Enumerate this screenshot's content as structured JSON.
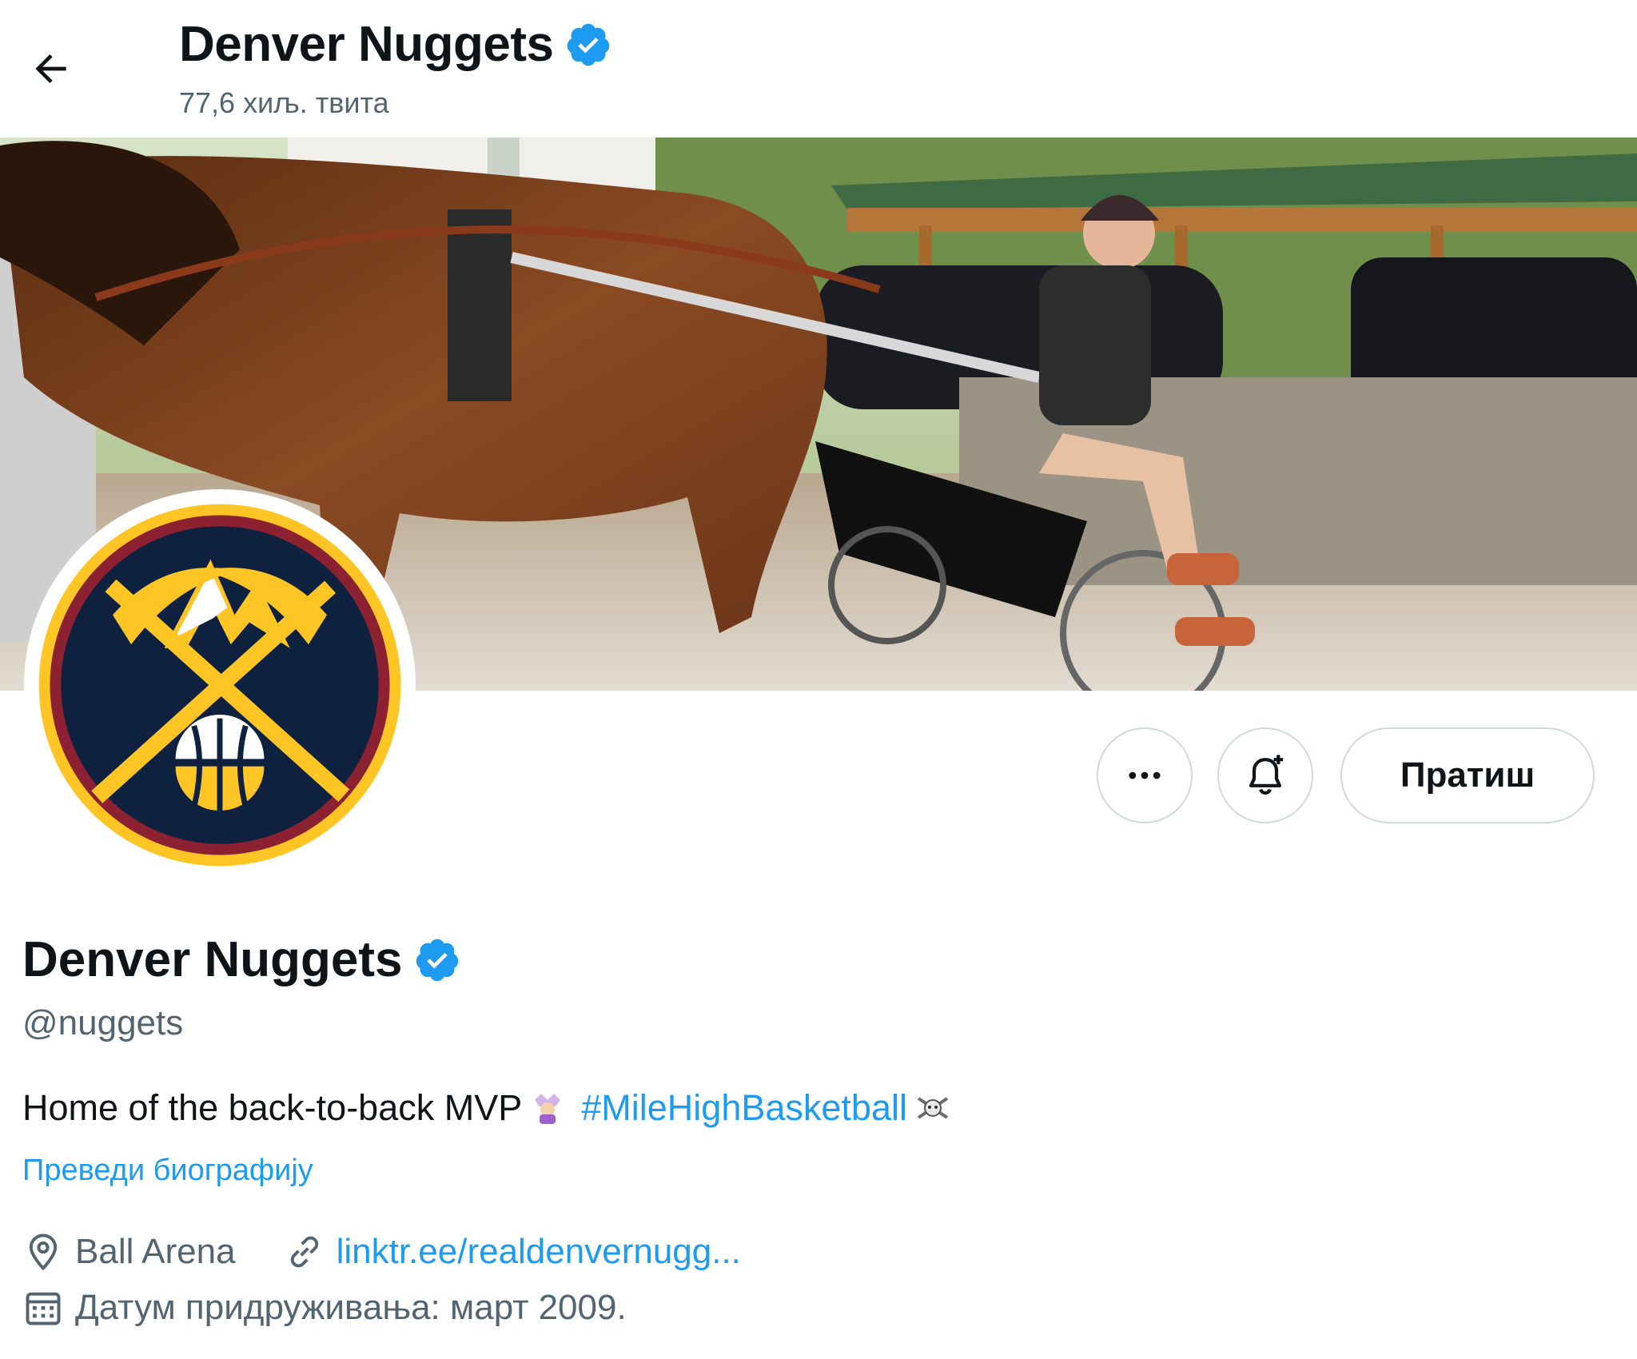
{
  "header": {
    "back_icon": "arrow-left-icon",
    "title": "Denver Nuggets",
    "tweet_count": "77,6 хиљ. твита"
  },
  "banner": {
    "image": "photo: person driving a horse-drawn sulky cart"
  },
  "avatar": {
    "logo": "Denver Nuggets logo",
    "colors": {
      "navy": "#0e2240",
      "gold": "#fec524",
      "red": "#8b2131"
    }
  },
  "actions": {
    "more_icon": "more-horizontal-icon",
    "notify_icon": "bell-plus-icon",
    "follow_label": "Пратиш"
  },
  "profile": {
    "name": "Denver Nuggets",
    "handle": "@nuggets",
    "bio_text": "Home of the back-to-back MVP",
    "bio_hashtag": "#MileHighBasketball",
    "translate_label": "Преведи биографију",
    "location": "Ball Arena",
    "website": "linktr.ee/realdenvernugg...",
    "joined": "Датум придруживања: март 2009."
  },
  "colors": {
    "accent": "#1d9bf0",
    "text": "#0f1419",
    "muted": "#536471",
    "border": "#cfd9de"
  }
}
